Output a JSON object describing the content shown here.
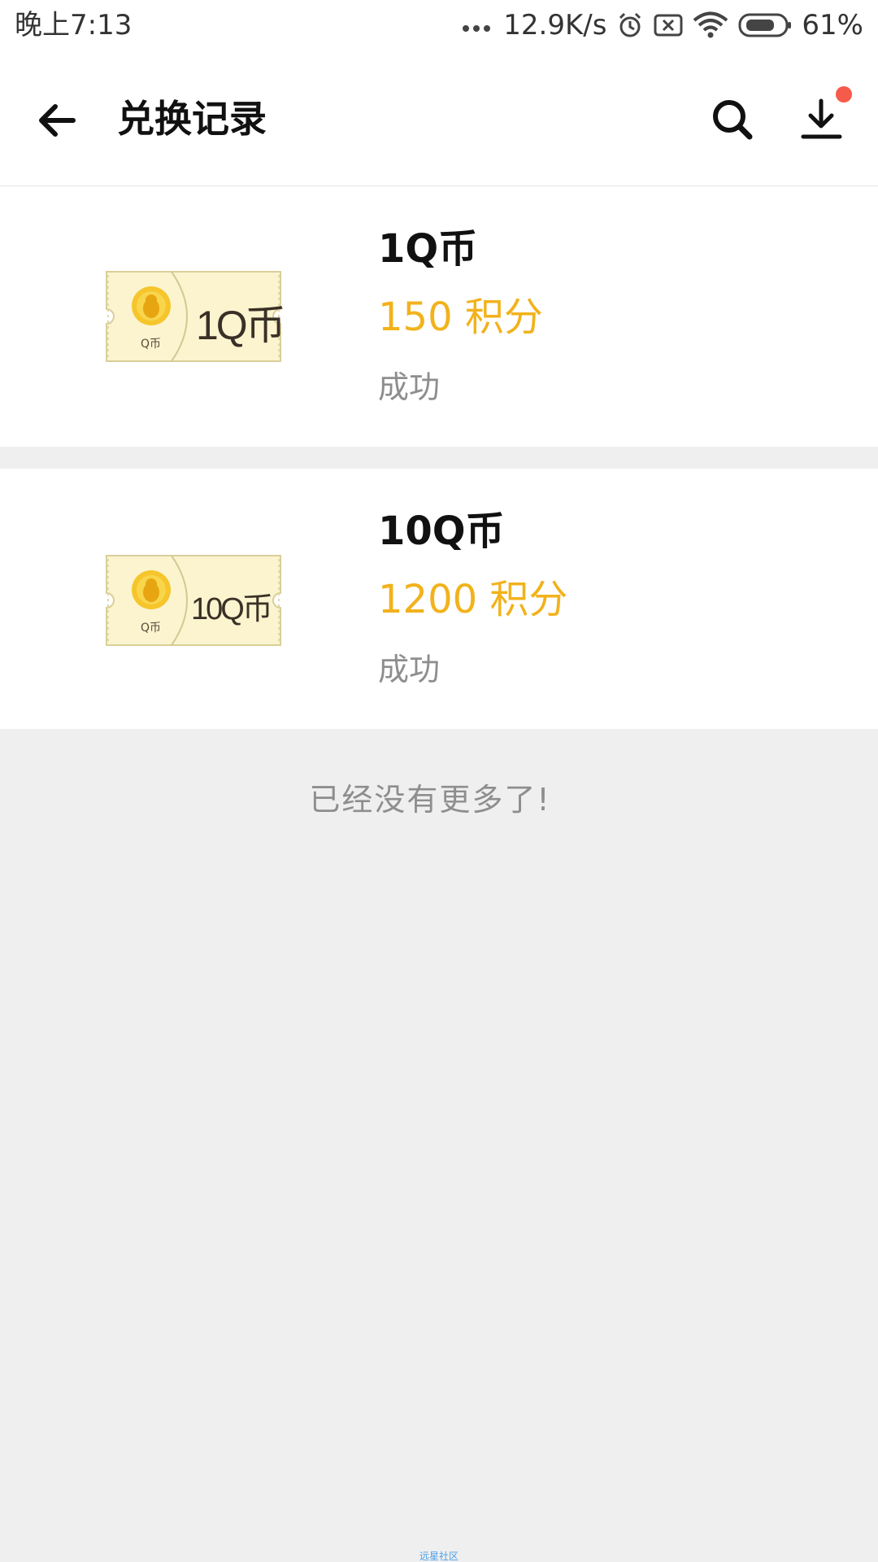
{
  "status_bar": {
    "time": "晚上7:13",
    "network_speed": "12.9K/s",
    "battery": "61%",
    "icons": [
      "more-dots-icon",
      "alarm-icon",
      "sim-off-icon",
      "wifi-icon",
      "battery-icon"
    ]
  },
  "nav": {
    "title": "兑换记录",
    "icons": [
      "back-arrow-icon",
      "search-icon",
      "download-icon"
    ],
    "badge_color": "#f65a4a"
  },
  "records": [
    {
      "name": "1Q币",
      "points": "150 积分",
      "status": "成功",
      "ticket_amount": "1Q币",
      "ticket_label": "Q币"
    },
    {
      "name": "10Q币",
      "points": "1200 积分",
      "status": "成功",
      "ticket_amount": "10Q币",
      "ticket_label": "Q币"
    }
  ],
  "footer": {
    "no_more": "已经没有更多了!",
    "watermark": "远星社区"
  },
  "colors": {
    "accent": "#f2b21c",
    "background": "#efefef",
    "ticket_fill": "#fbf4cf"
  }
}
